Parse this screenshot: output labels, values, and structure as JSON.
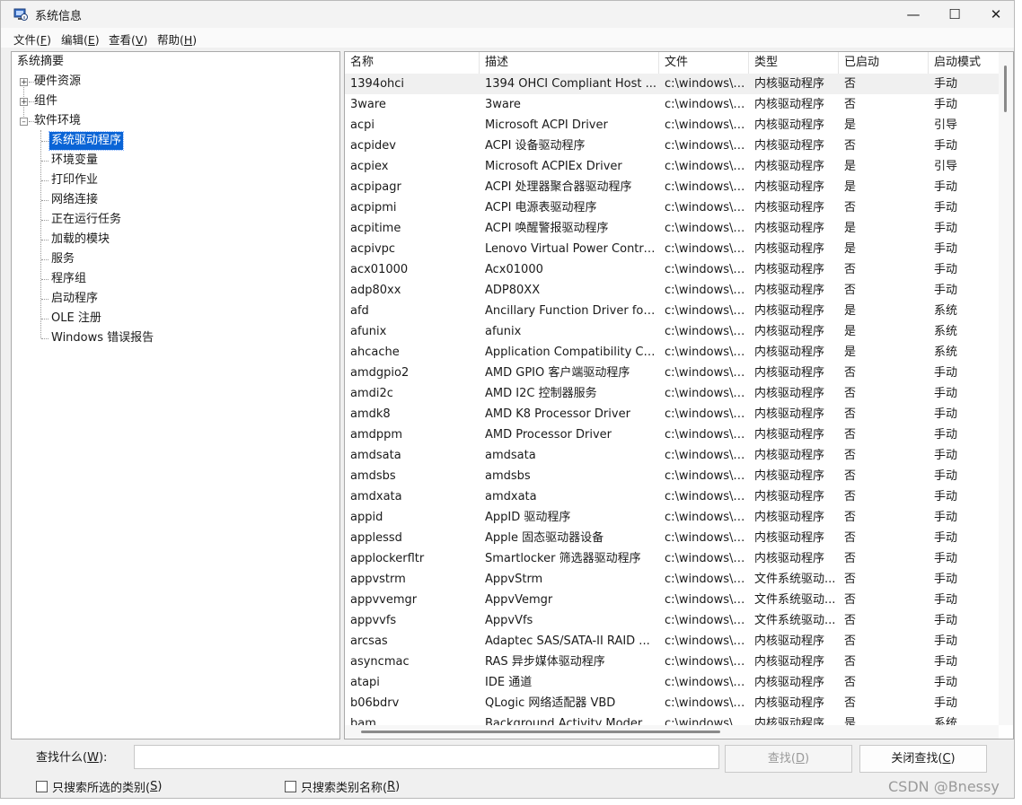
{
  "window": {
    "title": "系统信息"
  },
  "menu": [
    {
      "text": "文件(",
      "key": "F",
      "close": ")"
    },
    {
      "text": "编辑(",
      "key": "E",
      "close": ")"
    },
    {
      "text": "查看(",
      "key": "V",
      "close": ")"
    },
    {
      "text": "帮助(",
      "key": "H",
      "close": ")"
    }
  ],
  "tree": {
    "root": "系统摘要",
    "hardware": "硬件资源",
    "components": "组件",
    "software": "软件环境",
    "children": [
      "系统驱动程序",
      "环境变量",
      "打印作业",
      "网络连接",
      "正在运行任务",
      "加载的模块",
      "服务",
      "程序组",
      "启动程序",
      "OLE 注册",
      "Windows 错误报告"
    ]
  },
  "columns": [
    "名称",
    "描述",
    "文件",
    "类型",
    "已启动",
    "启动模式"
  ],
  "rows": [
    [
      "1394ohci",
      "1394 OHCI Compliant Host ...",
      "c:\\windows\\s...",
      "内核驱动程序",
      "否",
      "手动"
    ],
    [
      "3ware",
      "3ware",
      "c:\\windows\\s...",
      "内核驱动程序",
      "否",
      "手动"
    ],
    [
      "acpi",
      "Microsoft ACPI Driver",
      "c:\\windows\\s...",
      "内核驱动程序",
      "是",
      "引导"
    ],
    [
      "acpidev",
      "ACPI 设备驱动程序",
      "c:\\windows\\s...",
      "内核驱动程序",
      "否",
      "手动"
    ],
    [
      "acpiex",
      "Microsoft ACPIEx Driver",
      "c:\\windows\\s...",
      "内核驱动程序",
      "是",
      "引导"
    ],
    [
      "acpipagr",
      "ACPI 处理器聚合器驱动程序",
      "c:\\windows\\s...",
      "内核驱动程序",
      "是",
      "手动"
    ],
    [
      "acpipmi",
      "ACPI 电源表驱动程序",
      "c:\\windows\\s...",
      "内核驱动程序",
      "否",
      "手动"
    ],
    [
      "acpitime",
      "ACPI 唤醒警报驱动程序",
      "c:\\windows\\s...",
      "内核驱动程序",
      "是",
      "手动"
    ],
    [
      "acpivpc",
      "Lenovo Virtual Power Contro...",
      "c:\\windows\\s...",
      "内核驱动程序",
      "是",
      "手动"
    ],
    [
      "acx01000",
      "Acx01000",
      "c:\\windows\\s...",
      "内核驱动程序",
      "否",
      "手动"
    ],
    [
      "adp80xx",
      "ADP80XX",
      "c:\\windows\\s...",
      "内核驱动程序",
      "否",
      "手动"
    ],
    [
      "afd",
      "Ancillary Function Driver for ...",
      "c:\\windows\\s...",
      "内核驱动程序",
      "是",
      "系统"
    ],
    [
      "afunix",
      "afunix",
      "c:\\windows\\s...",
      "内核驱动程序",
      "是",
      "系统"
    ],
    [
      "ahcache",
      "Application Compatibility Ca...",
      "c:\\windows\\s...",
      "内核驱动程序",
      "是",
      "系统"
    ],
    [
      "amdgpio2",
      "AMD GPIO 客户端驱动程序",
      "c:\\windows\\s...",
      "内核驱动程序",
      "否",
      "手动"
    ],
    [
      "amdi2c",
      "AMD I2C 控制器服务",
      "c:\\windows\\s...",
      "内核驱动程序",
      "否",
      "手动"
    ],
    [
      "amdk8",
      "AMD K8 Processor Driver",
      "c:\\windows\\s...",
      "内核驱动程序",
      "否",
      "手动"
    ],
    [
      "amdppm",
      "AMD Processor Driver",
      "c:\\windows\\s...",
      "内核驱动程序",
      "否",
      "手动"
    ],
    [
      "amdsata",
      "amdsata",
      "c:\\windows\\s...",
      "内核驱动程序",
      "否",
      "手动"
    ],
    [
      "amdsbs",
      "amdsbs",
      "c:\\windows\\s...",
      "内核驱动程序",
      "否",
      "手动"
    ],
    [
      "amdxata",
      "amdxata",
      "c:\\windows\\s...",
      "内核驱动程序",
      "否",
      "手动"
    ],
    [
      "appid",
      "AppID 驱动程序",
      "c:\\windows\\s...",
      "内核驱动程序",
      "否",
      "手动"
    ],
    [
      "applessd",
      "Apple 固态驱动器设备",
      "c:\\windows\\s...",
      "内核驱动程序",
      "否",
      "手动"
    ],
    [
      "applockerfltr",
      "Smartlocker 筛选器驱动程序",
      "c:\\windows\\s...",
      "内核驱动程序",
      "否",
      "手动"
    ],
    [
      "appvstrm",
      "AppvStrm",
      "c:\\windows\\s...",
      "文件系统驱动...",
      "否",
      "手动"
    ],
    [
      "appvvemgr",
      "AppvVemgr",
      "c:\\windows\\s...",
      "文件系统驱动...",
      "否",
      "手动"
    ],
    [
      "appvvfs",
      "AppvVfs",
      "c:\\windows\\s...",
      "文件系统驱动...",
      "否",
      "手动"
    ],
    [
      "arcsas",
      "Adaptec SAS/SATA-II RAID ...",
      "c:\\windows\\s...",
      "内核驱动程序",
      "否",
      "手动"
    ],
    [
      "asyncmac",
      "RAS 异步媒体驱动程序",
      "c:\\windows\\s...",
      "内核驱动程序",
      "否",
      "手动"
    ],
    [
      "atapi",
      "IDE 通道",
      "c:\\windows\\s...",
      "内核驱动程序",
      "否",
      "手动"
    ],
    [
      "b06bdrv",
      "QLogic 网络适配器 VBD",
      "c:\\windows\\s...",
      "内核驱动程序",
      "否",
      "手动"
    ],
    [
      "bam",
      "Background Activity Modera...",
      "c:\\windows\\s...",
      "内核驱动程序",
      "是",
      "系统"
    ]
  ],
  "find": {
    "label_pre": "查找什么(",
    "label_key": "W",
    "label_post": "):",
    "value": "",
    "find_button_pre": "查找(",
    "find_button_key": "D",
    "find_button_post": ")",
    "close_button_pre": "关闭查找(",
    "close_button_key": "C",
    "close_button_post": ")",
    "opt1_pre": "只搜索所选的类别(",
    "opt1_key": "S",
    "opt1_post": ")",
    "opt2_pre": "只搜索类别名称(",
    "opt2_key": "R",
    "opt2_post": ")"
  },
  "watermark": "CSDN @Bnessy",
  "colors": {
    "selection": "#0a64d6"
  }
}
